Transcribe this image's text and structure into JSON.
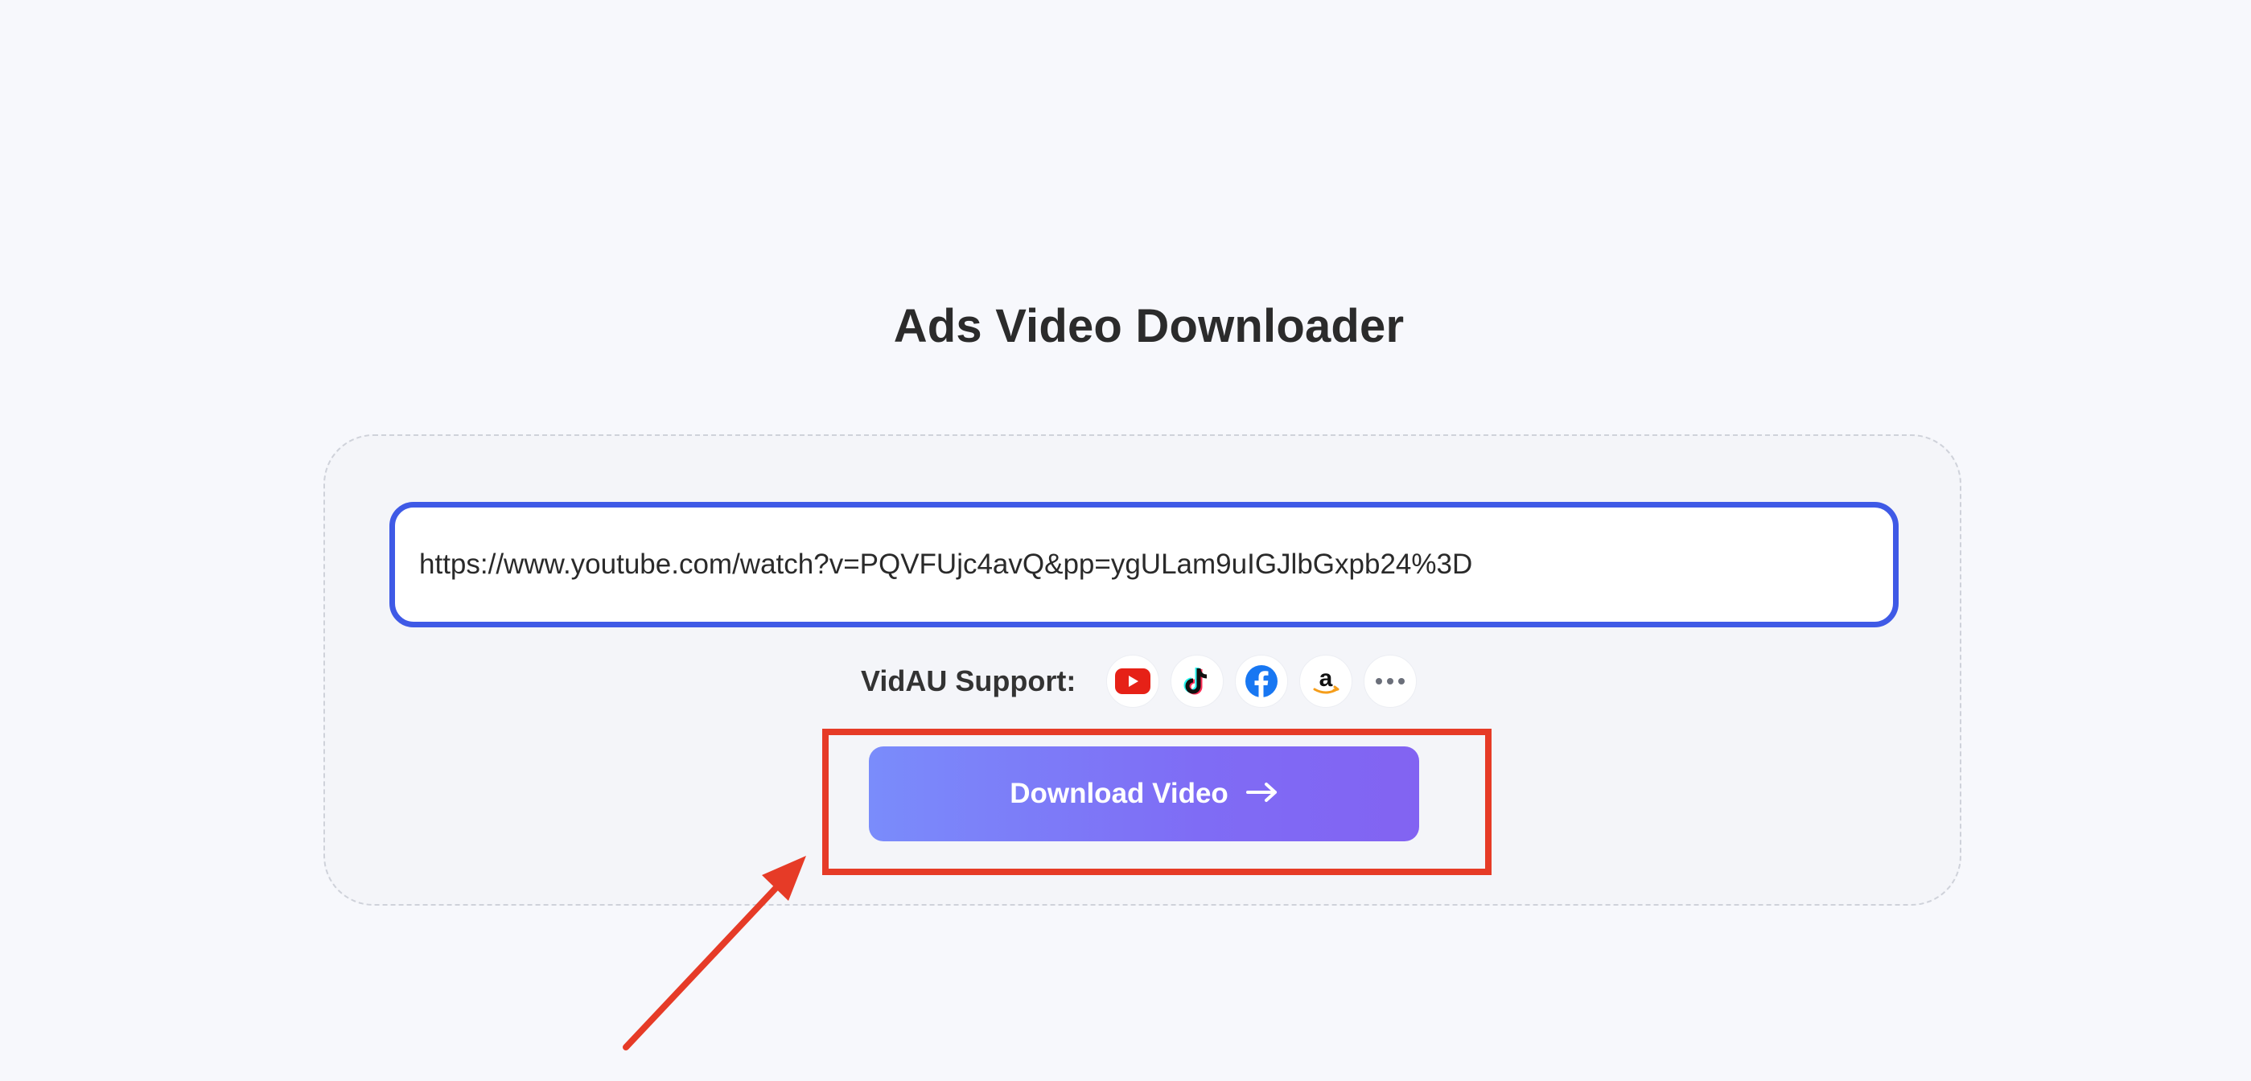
{
  "page": {
    "title": "Ads Video Downloader"
  },
  "url_input": {
    "value": "https://www.youtube.com/watch?v=PQVFUjc4avQ&pp=ygULam9uIGJlbGxpb24%3D"
  },
  "support": {
    "label": "VidAU Support:",
    "platforms": [
      {
        "icon": "youtube-icon"
      },
      {
        "icon": "tiktok-icon"
      },
      {
        "icon": "facebook-icon"
      },
      {
        "icon": "amazon-icon"
      },
      {
        "icon": "more-icon"
      }
    ]
  },
  "download_button": {
    "label": "Download Video",
    "icon": "arrow-right-icon"
  },
  "annotation": {
    "highlight_color": "#e63b27"
  },
  "colors": {
    "input_border": "#3f5ae6",
    "button_gradient_start": "#7a8cfb",
    "button_gradient_end": "#8263f2",
    "youtube": "#e62117",
    "facebook": "#1877f2",
    "amazon_smile": "#f59d1a"
  }
}
